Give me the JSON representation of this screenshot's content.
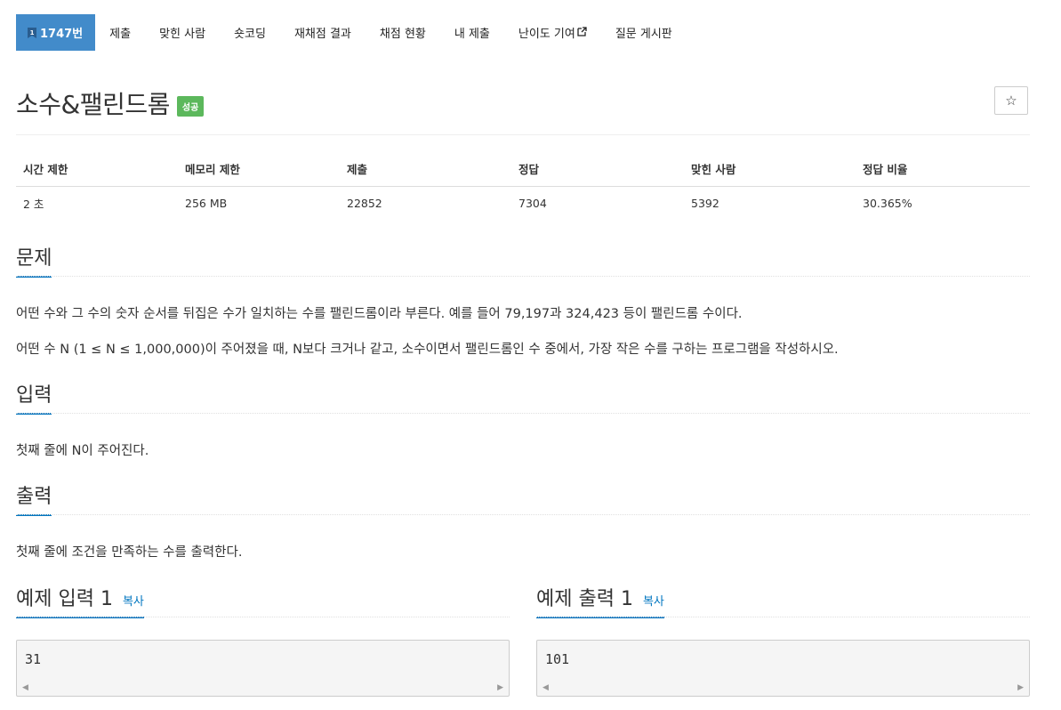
{
  "tabs": [
    {
      "label": "1747번",
      "active": true
    },
    {
      "label": "제출"
    },
    {
      "label": "맞힌 사람"
    },
    {
      "label": "숏코딩"
    },
    {
      "label": "재채점 결과"
    },
    {
      "label": "채점 현황"
    },
    {
      "label": "내 제출"
    },
    {
      "label": "난이도 기여"
    },
    {
      "label": "질문 게시판"
    }
  ],
  "problem": {
    "title": "소수&팰린드롬",
    "status_badge": "성공",
    "star_icon": "☆"
  },
  "info_table": {
    "headers": [
      "시간 제한",
      "메모리 제한",
      "제출",
      "정답",
      "맞힌 사람",
      "정답 비율"
    ],
    "values": [
      "2 초",
      "256 MB",
      "22852",
      "7304",
      "5392",
      "30.365%"
    ]
  },
  "sections": {
    "problem": {
      "heading": "문제",
      "paragraphs": [
        "어떤 수와 그 수의 숫자 순서를 뒤집은 수가 일치하는 수를 팰린드롬이라 부른다. 예를 들어 79,197과 324,423 등이 팰린드롬 수이다.",
        "어떤 수 N (1 ≤ N ≤ 1,000,000)이 주어졌을 때, N보다 크거나 같고, 소수이면서 팰린드롬인 수 중에서, 가장 작은 수를 구하는 프로그램을 작성하시오."
      ]
    },
    "input": {
      "heading": "입력",
      "text": "첫째 줄에 N이 주어진다."
    },
    "output": {
      "heading": "출력",
      "text": "첫째 줄에 조건을 만족하는 수를 출력한다."
    }
  },
  "samples": {
    "input": {
      "heading": "예제 입력 1",
      "copy_label": "복사",
      "content": "31"
    },
    "output": {
      "heading": "예제 출력 1",
      "copy_label": "복사",
      "content": "101"
    }
  },
  "colors": {
    "tab_active": "#428bca",
    "badge_success": "#5cb85c",
    "accent": "#0076c0"
  }
}
